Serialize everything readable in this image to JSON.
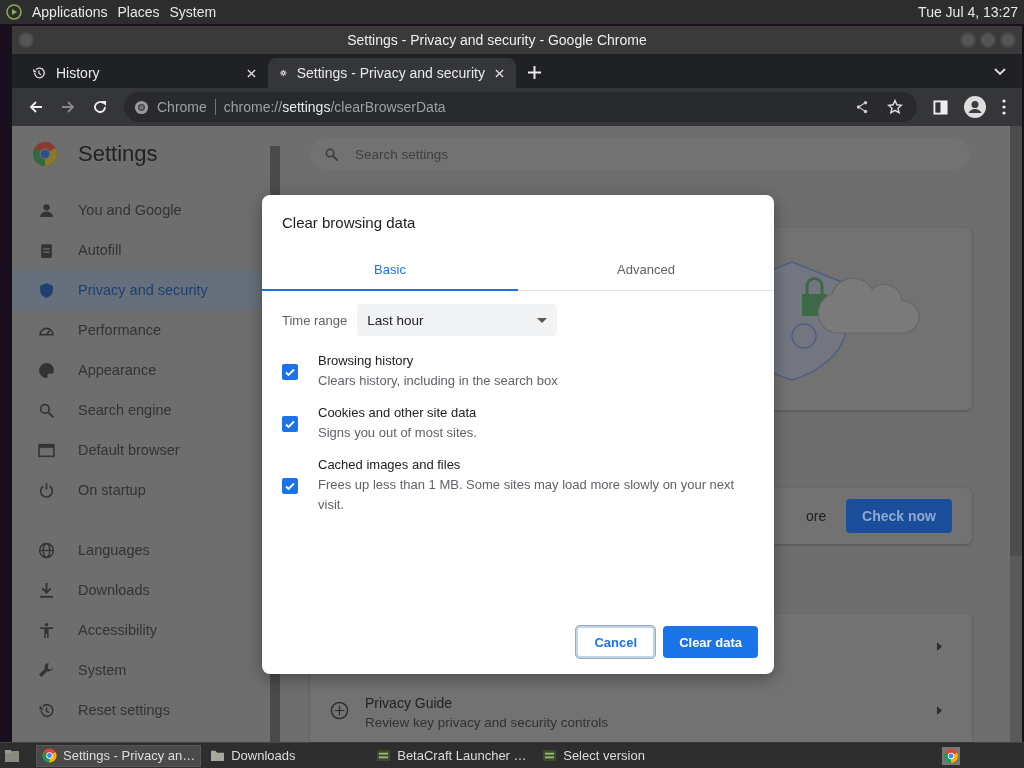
{
  "top_panel": {
    "menus": [
      "Applications",
      "Places",
      "System"
    ],
    "clock": "Tue Jul  4, 13:27"
  },
  "window": {
    "title": "Settings - Privacy and security - Google Chrome"
  },
  "tabs": [
    {
      "label": "History",
      "selected": false
    },
    {
      "label": "Settings - Privacy and security",
      "selected": true
    }
  ],
  "address_bar": {
    "site_label": "Chrome",
    "url_scheme": "chrome://",
    "url_host": "settings",
    "url_path": "/clearBrowserData"
  },
  "settings": {
    "title": "Settings",
    "search_placeholder": "Search settings",
    "nav_groups": [
      [
        {
          "label": "You and Google",
          "selected": false
        },
        {
          "label": "Autofill",
          "selected": false
        },
        {
          "label": "Privacy and security",
          "selected": true
        },
        {
          "label": "Performance",
          "selected": false
        },
        {
          "label": "Appearance",
          "selected": false
        },
        {
          "label": "Search engine",
          "selected": false
        },
        {
          "label": "Default browser",
          "selected": false
        },
        {
          "label": "On startup",
          "selected": false
        }
      ],
      [
        {
          "label": "Languages",
          "selected": false
        },
        {
          "label": "Downloads",
          "selected": false
        },
        {
          "label": "Accessibility",
          "selected": false
        },
        {
          "label": "System",
          "selected": false
        },
        {
          "label": "Reset settings",
          "selected": false
        }
      ]
    ]
  },
  "background": {
    "link_text": "ore",
    "check_button": "Check now",
    "privacy_guide": {
      "title": "Privacy Guide",
      "description": "Review key privacy and security controls"
    }
  },
  "dialog": {
    "title": "Clear browsing data",
    "tabs": [
      {
        "label": "Basic",
        "selected": true
      },
      {
        "label": "Advanced",
        "selected": false
      }
    ],
    "time_range": {
      "label": "Time range",
      "value": "Last hour"
    },
    "options": [
      {
        "title": "Browsing history",
        "description": "Clears history, including in the search box",
        "checked": true
      },
      {
        "title": "Cookies and other site data",
        "description": "Signs you out of most sites.",
        "checked": true
      },
      {
        "title": "Cached images and files",
        "description": "Frees up less than 1 MB. Some sites may load more slowly on your next visit.",
        "checked": true
      }
    ],
    "buttons": [
      {
        "label": "Cancel",
        "kind": "secondary"
      },
      {
        "label": "Clear data",
        "kind": "primary"
      }
    ]
  },
  "taskbar": {
    "items": [
      {
        "label": "Settings - Privacy an…",
        "selected": true
      },
      {
        "label": "Downloads",
        "selected": false
      },
      {
        "label": "BetaCraft Launcher …",
        "selected": false
      },
      {
        "label": "Select version",
        "selected": false
      }
    ]
  }
}
